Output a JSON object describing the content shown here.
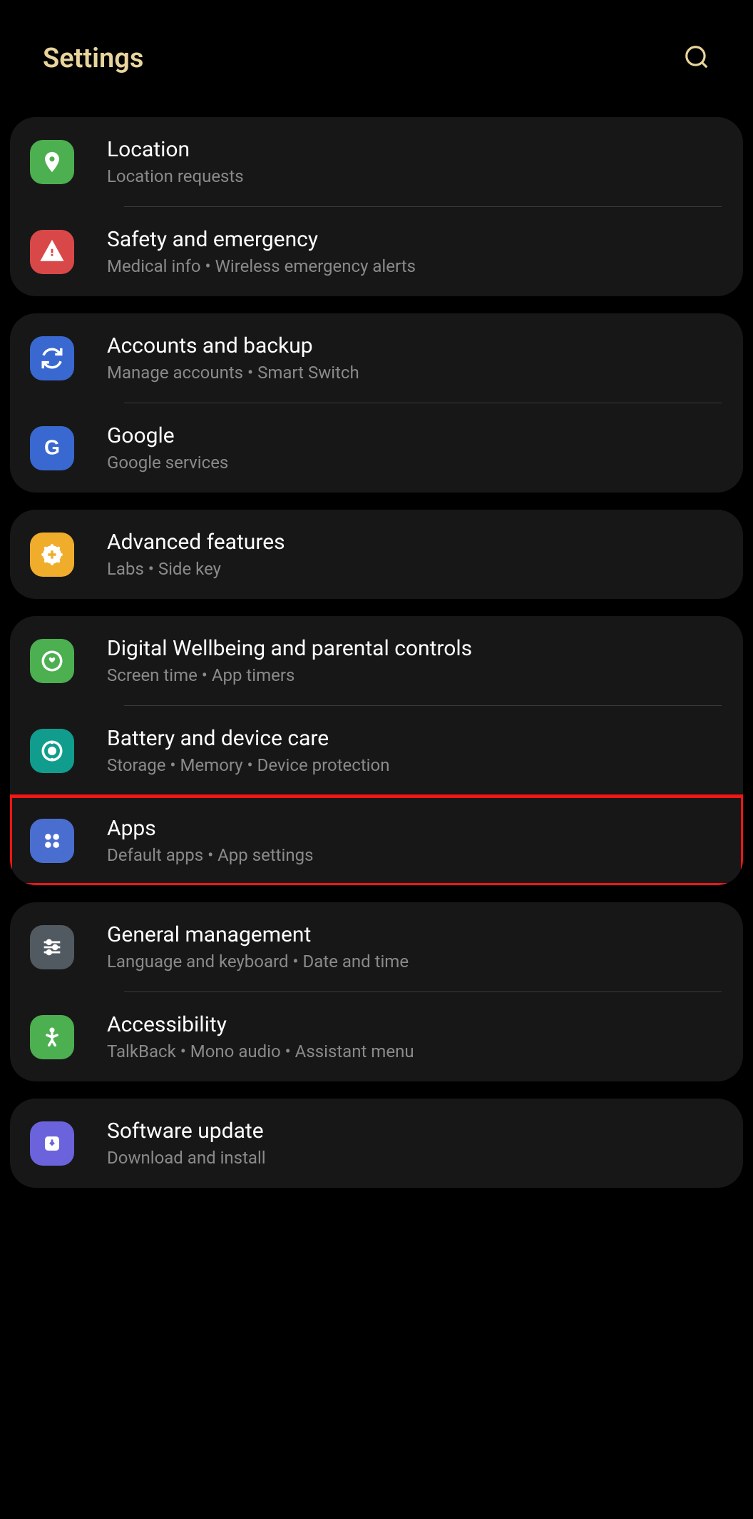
{
  "header": {
    "title": "Settings"
  },
  "groups": [
    {
      "items": [
        {
          "id": "location",
          "title": "Location",
          "subtitle": "Location requests",
          "icon": "location-pin-icon",
          "bg": "bg-green"
        },
        {
          "id": "safety",
          "title": "Safety and emergency",
          "subtitle": "Medical info  •  Wireless emergency alerts",
          "icon": "alert-icon",
          "bg": "bg-red"
        }
      ]
    },
    {
      "items": [
        {
          "id": "accounts",
          "title": "Accounts and backup",
          "subtitle": "Manage accounts  •  Smart Switch",
          "icon": "sync-icon",
          "bg": "bg-blue"
        },
        {
          "id": "google",
          "title": "Google",
          "subtitle": "Google services",
          "icon": "google-icon",
          "bg": "bg-blue"
        }
      ]
    },
    {
      "items": [
        {
          "id": "advanced",
          "title": "Advanced features",
          "subtitle": "Labs  •  Side key",
          "icon": "plus-gear-icon",
          "bg": "bg-yellow"
        }
      ]
    },
    {
      "items": [
        {
          "id": "wellbeing",
          "title": "Digital Wellbeing and parental controls",
          "subtitle": "Screen time  •  App timers",
          "icon": "wellbeing-icon",
          "bg": "bg-green2"
        },
        {
          "id": "battery",
          "title": "Battery and device care",
          "subtitle": "Storage  •  Memory  •  Device protection",
          "icon": "care-icon",
          "bg": "bg-teal"
        },
        {
          "id": "apps",
          "title": "Apps",
          "subtitle": "Default apps  •  App settings",
          "icon": "apps-icon",
          "bg": "bg-blue2",
          "highlighted": true
        }
      ]
    },
    {
      "items": [
        {
          "id": "general",
          "title": "General management",
          "subtitle": "Language and keyboard  •  Date and time",
          "icon": "sliders-icon",
          "bg": "bg-gray"
        },
        {
          "id": "accessibility",
          "title": "Accessibility",
          "subtitle": "TalkBack  •  Mono audio  •  Assistant menu",
          "icon": "accessibility-icon",
          "bg": "bg-green"
        }
      ]
    },
    {
      "items": [
        {
          "id": "software",
          "title": "Software update",
          "subtitle": "Download and install",
          "icon": "update-icon",
          "bg": "bg-purple"
        }
      ]
    }
  ]
}
